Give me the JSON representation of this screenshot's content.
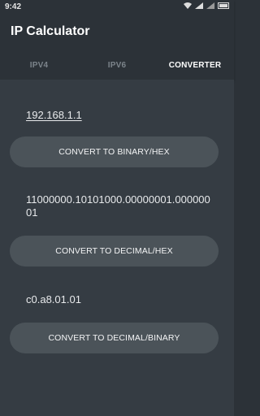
{
  "status": {
    "time": "9:42"
  },
  "app": {
    "title": "IP Calculator"
  },
  "tabs": [
    {
      "label": "IPV4"
    },
    {
      "label": "IPV6"
    },
    {
      "label": "CONVERTER"
    }
  ],
  "converter": {
    "ip_value": "192.168.1.1",
    "to_binary_hex_label": "CONVERT TO BINARY/HEX",
    "binary_value": "11000000.10101000.00000001.00000001",
    "to_decimal_hex_label": "CONVERT TO DECIMAL/HEX",
    "hex_value": "c0.a8.01.01",
    "to_decimal_binary_label": "CONVERT TO DECIMAL/BINARY"
  },
  "colors": {
    "background": "#353c43",
    "appbar": "#2c3238",
    "button": "#4b5359"
  }
}
